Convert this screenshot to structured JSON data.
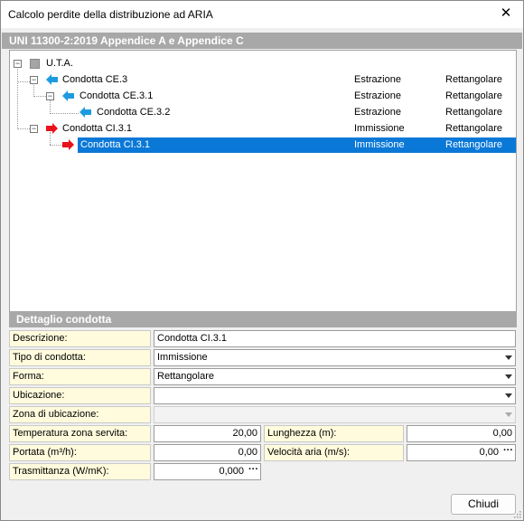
{
  "window": {
    "title": "Calcolo perdite della distribuzione ad ARIA"
  },
  "section_title": "UNI 11300-2:2019 Appendice A e Appendice C",
  "tree": [
    {
      "label": "U.T.A.",
      "tipo": "",
      "forma": "",
      "icon": "square-icon"
    },
    {
      "label": "Condotta CE.3",
      "tipo": "Estrazione",
      "forma": "Rettangolare",
      "icon": "blue-arrow-left-icon"
    },
    {
      "label": "Condotta CE.3.1",
      "tipo": "Estrazione",
      "forma": "Rettangolare",
      "icon": "blue-arrow-left-icon"
    },
    {
      "label": "Condotta CE.3.2",
      "tipo": "Estrazione",
      "forma": "Rettangolare",
      "icon": "blue-arrow-left-icon"
    },
    {
      "label": "Condotta CI.3.1",
      "tipo": "Immissione",
      "forma": "Rettangolare",
      "icon": "red-arrow-right-icon"
    },
    {
      "label": "Condotta CI.3.1",
      "tipo": "Immissione",
      "forma": "Rettangolare",
      "icon": "red-arrow-right-icon",
      "selected": true
    }
  ],
  "details": {
    "title": "Dettaglio condotta",
    "descrizione": {
      "label": "Descrizione:",
      "value": "Condotta CI.3.1"
    },
    "tipo": {
      "label": "Tipo di condotta:",
      "value": "Immissione"
    },
    "forma": {
      "label": "Forma:",
      "value": "Rettangolare"
    },
    "ubicazione": {
      "label": "Ubicazione:",
      "value": ""
    },
    "zona": {
      "label": "Zona di ubicazione:",
      "value": ""
    },
    "temperatura": {
      "label": "Temperatura zona servita:",
      "value": "20,00"
    },
    "lunghezza": {
      "label": "Lunghezza (m):",
      "value": "0,00"
    },
    "portata": {
      "label": "Portata (m³/h):",
      "value": "0,00"
    },
    "velocita": {
      "label": "Velocità aria (m/s):",
      "value": "0,00"
    },
    "trasmittanza": {
      "label": "Trasmittanza (W/mK):",
      "value": "0,000"
    }
  },
  "buttons": {
    "close": "Chiudi"
  },
  "colors": {
    "selection": "#0a78d7",
    "label_bg": "#fffbdc",
    "header_bg": "#a8a8a8",
    "blue_arrow": "#1e9be0",
    "red_arrow": "#e8121d"
  }
}
